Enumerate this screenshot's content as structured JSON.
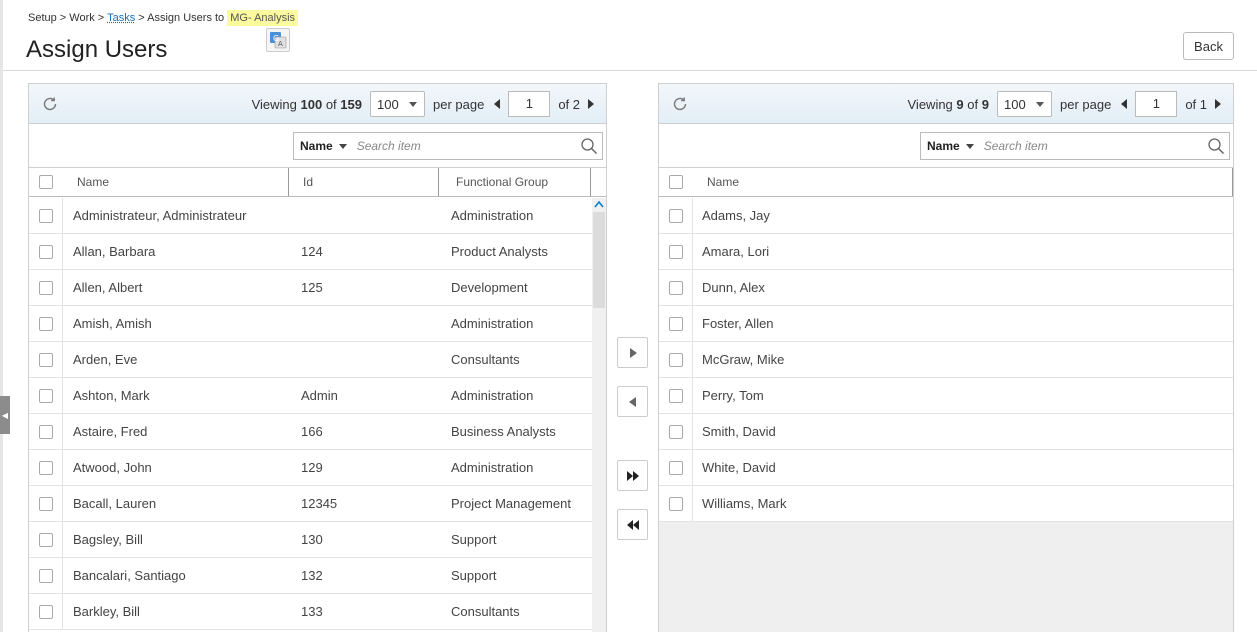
{
  "breadcrumb": {
    "part1": "Setup > Work > ",
    "tasks": "Tasks",
    "part2": " > Assign Users to ",
    "project": "MG- Analysis"
  },
  "page_title": "Assign Users",
  "back_label": "Back",
  "available": {
    "viewing_label": "Viewing",
    "viewing_count": "100",
    "of_label": "of",
    "total": "159",
    "per_page_value": "100",
    "per_page_label": "per page",
    "page": "1",
    "of_pages": "of 2",
    "search_field": "Name",
    "search_placeholder": "Search item",
    "columns": [
      "Name",
      "Id",
      "Functional Group"
    ],
    "rows": [
      {
        "name": "Administrateur, Administrateur",
        "id": "",
        "group": "Administration"
      },
      {
        "name": "Allan, Barbara",
        "id": "124",
        "group": "Product Analysts"
      },
      {
        "name": "Allen, Albert",
        "id": "125",
        "group": "Development"
      },
      {
        "name": "Amish, Amish",
        "id": "",
        "group": "Administration"
      },
      {
        "name": "Arden, Eve",
        "id": "",
        "group": "Consultants"
      },
      {
        "name": "Ashton, Mark",
        "id": "Admin",
        "group": "Administration"
      },
      {
        "name": "Astaire, Fred",
        "id": "166",
        "group": "Business Analysts"
      },
      {
        "name": "Atwood, John",
        "id": "129",
        "group": "Administration"
      },
      {
        "name": "Bacall, Lauren",
        "id": "12345",
        "group": "Project Management"
      },
      {
        "name": "Bagsley, Bill",
        "id": "130",
        "group": "Support"
      },
      {
        "name": "Bancalari, Santiago",
        "id": "132",
        "group": "Support"
      },
      {
        "name": "Barkley, Bill",
        "id": "133",
        "group": "Consultants"
      }
    ]
  },
  "assigned": {
    "viewing_label": "Viewing",
    "viewing_count": "9",
    "of_label": "of",
    "total": "9",
    "per_page_value": "100",
    "per_page_label": "per page",
    "page": "1",
    "of_pages": "of 1",
    "search_field": "Name",
    "search_placeholder": "Search item",
    "columns": [
      "Name"
    ],
    "rows": [
      {
        "name": "Adams, Jay"
      },
      {
        "name": "Amara, Lori"
      },
      {
        "name": "Dunn, Alex"
      },
      {
        "name": "Foster, Allen"
      },
      {
        "name": "McGraw, Mike"
      },
      {
        "name": "Perry, Tom"
      },
      {
        "name": "Smith, David"
      },
      {
        "name": "White, David"
      },
      {
        "name": "Williams, Mark"
      }
    ]
  },
  "icons": {
    "refresh": "refresh-icon",
    "search": "search-icon",
    "move_right": "arrow-right-icon",
    "move_left": "arrow-left-icon",
    "move_all_right": "double-arrow-right-icon",
    "move_all_left": "double-arrow-left-icon",
    "translate": "translate-icon"
  },
  "colors": {
    "link": "#1a6fb5",
    "highlight": "#fbfa9e",
    "pager_bg": "#e3eef6",
    "scroll_accent": "#0b7fc7"
  }
}
